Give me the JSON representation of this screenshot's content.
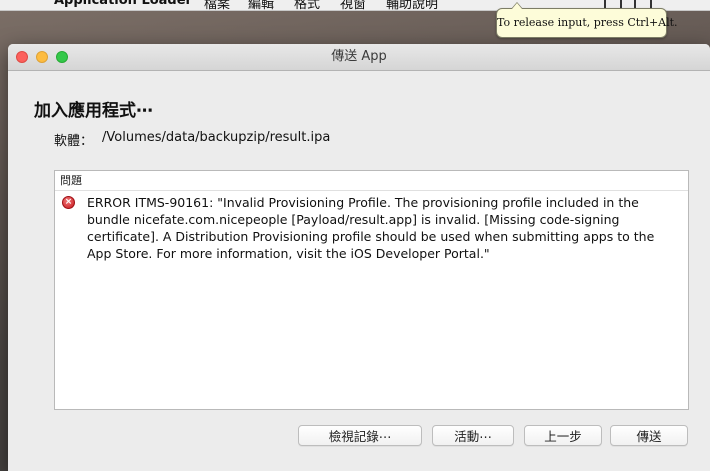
{
  "menubar": {
    "apple_icon": "apple-icon",
    "app_name": "Application Loader",
    "items": [
      "檔案",
      "編輯",
      "格式",
      "視窗",
      "輔助說明"
    ]
  },
  "tooltip": {
    "text": "To release input, press Ctrl+Alt."
  },
  "window": {
    "title": "傳送 App",
    "heading": "加入應用程式⋯",
    "software_label": "軟體：",
    "software_path": "/Volumes/data/backupzip/result.ipa",
    "issues_header": "問題",
    "error_icon": "error-icon",
    "error_message": "ERROR ITMS-90161: \"Invalid Provisioning Profile. The provisioning profile included in the bundle nicefate.com.nicepeople [Payload/result.app] is invalid. [Missing code-signing certificate]. A Distribution Provisioning profile should be used when submitting apps to the App Store. For more information, visit the iOS Developer Portal.\"",
    "buttons": {
      "view_log": "檢視記錄⋯",
      "activity": "活動⋯",
      "back": "上一步",
      "deliver": "傳送"
    }
  },
  "colors": {
    "close": "#fc605c",
    "minimize": "#fdbc40",
    "maximize": "#34c84a",
    "error": "#c8141b",
    "tooltip_bg": "#fdfcd9"
  }
}
